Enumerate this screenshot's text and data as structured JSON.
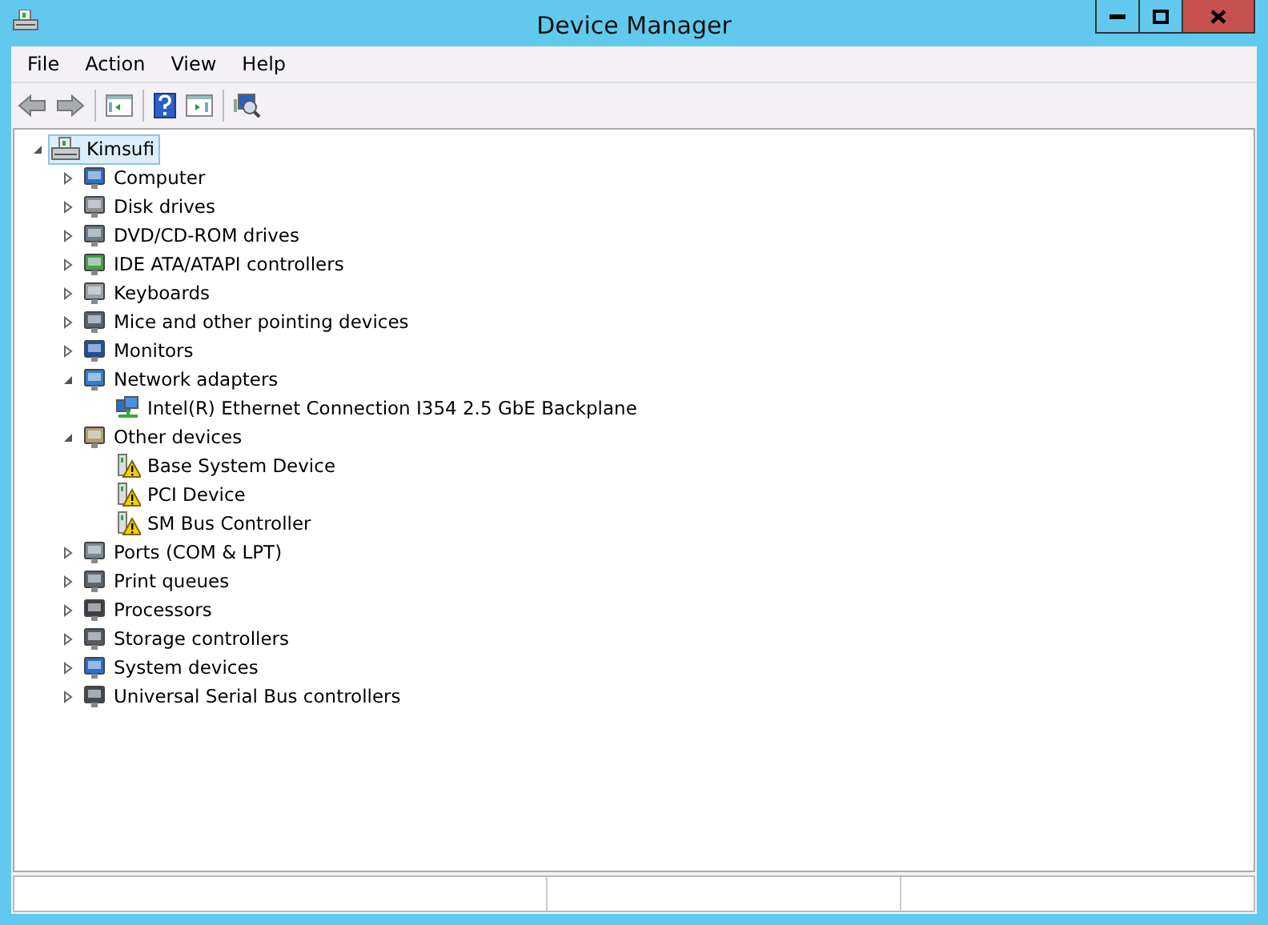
{
  "window": {
    "title": "Device Manager"
  },
  "menu": [
    "File",
    "Action",
    "View",
    "Help"
  ],
  "tree": {
    "label": "Kimsufi",
    "selected": true,
    "expanded": true,
    "children": [
      {
        "label": "Computer",
        "expanded": false
      },
      {
        "label": "Disk drives",
        "expanded": false
      },
      {
        "label": "DVD/CD-ROM drives",
        "expanded": false
      },
      {
        "label": "IDE ATA/ATAPI controllers",
        "expanded": false
      },
      {
        "label": "Keyboards",
        "expanded": false
      },
      {
        "label": "Mice and other pointing devices",
        "expanded": false
      },
      {
        "label": "Monitors",
        "expanded": false
      },
      {
        "label": "Network adapters",
        "expanded": true,
        "children": [
          {
            "label": "Intel(R) Ethernet Connection I354 2.5 GbE Backplane",
            "warning": false
          }
        ]
      },
      {
        "label": "Other devices",
        "expanded": true,
        "children": [
          {
            "label": "Base System Device",
            "warning": true
          },
          {
            "label": "PCI Device",
            "warning": true
          },
          {
            "label": "SM Bus Controller",
            "warning": true
          }
        ]
      },
      {
        "label": "Ports (COM & LPT)",
        "expanded": false
      },
      {
        "label": "Print queues",
        "expanded": false
      },
      {
        "label": "Processors",
        "expanded": false
      },
      {
        "label": "Storage controllers",
        "expanded": false
      },
      {
        "label": "System devices",
        "expanded": false
      },
      {
        "label": "Universal Serial Bus controllers",
        "expanded": false
      }
    ]
  }
}
